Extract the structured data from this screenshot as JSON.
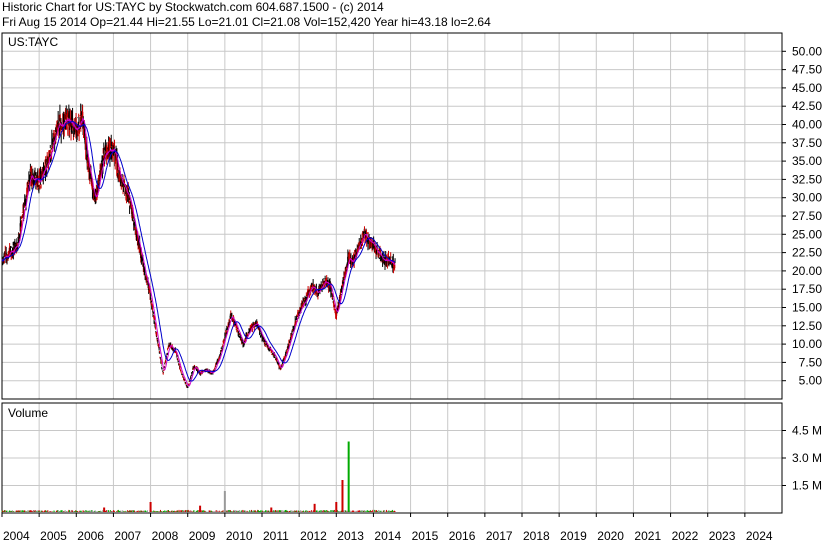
{
  "header": {
    "line1": "Historic Chart for US:TAYC by Stockwatch.com 604.687.1500 - (c) 2014",
    "line2": "Fri Aug 15 2014   Op=21.44  Hi=21.55  Lo=21.01  Cl=21.08  Vol=152,420  Year hi=43.18  lo=2.64"
  },
  "price_panel": {
    "label": "US:TAYC",
    "y_ticks": [
      "50.00",
      "47.50",
      "45.00",
      "42.50",
      "40.00",
      "37.50",
      "35.00",
      "32.50",
      "30.00",
      "27.50",
      "25.00",
      "22.50",
      "20.00",
      "17.50",
      "15.00",
      "12.50",
      "10.00",
      "7.50",
      "5.00"
    ]
  },
  "volume_panel": {
    "label": "Volume",
    "y_ticks": [
      "4.5 M",
      "3.0 M",
      "1.5 M"
    ]
  },
  "x_labels": [
    "2004",
    "2005",
    "2006",
    "2007",
    "2008",
    "2009",
    "2010",
    "2011",
    "2012",
    "2013",
    "2014",
    "2015",
    "2016",
    "2017",
    "2018",
    "2019",
    "2020",
    "2021",
    "2022",
    "2023",
    "2024"
  ],
  "colors": {
    "grid": "#c8c8c8",
    "price_bar_up": "#cc0000",
    "price_bar_down": "#000000",
    "ma_short": "#cc00cc",
    "ma_long": "#0000cc",
    "volume_up": "#00aa00",
    "volume_down": "#cc0000",
    "volume_flat": "#999999"
  },
  "chart_data": {
    "type": "line",
    "title": "Historic Chart for US:TAYC",
    "price": {
      "ylim": [
        2.5,
        52.5
      ],
      "series": [
        {
          "x": [
            "2004-01",
            "2004-06",
            "2004-10",
            "2005-01",
            "2005-04",
            "2005-07",
            "2005-10",
            "2006-01",
            "2006-03",
            "2006-05",
            "2006-07",
            "2006-10",
            "2007-01",
            "2007-03",
            "2007-06",
            "2007-09",
            "2007-11",
            "2008-01",
            "2008-03",
            "2008-05",
            "2008-07",
            "2008-09",
            "2008-11",
            "2009-01",
            "2009-03",
            "2009-05",
            "2009-07",
            "2009-09",
            "2009-11",
            "2010-01",
            "2010-03",
            "2010-05",
            "2010-07",
            "2010-09",
            "2010-11",
            "2011-01",
            "2011-03",
            "2011-05",
            "2011-07",
            "2011-09",
            "2011-11",
            "2012-01",
            "2012-03",
            "2012-05",
            "2012-07",
            "2012-09",
            "2012-11",
            "2013-01",
            "2013-03",
            "2013-05",
            "2013-06",
            "2013-08",
            "2013-10",
            "2013-12",
            "2014-02",
            "2014-04",
            "2014-06",
            "2014-08"
          ],
          "values": [
            21.5,
            23.5,
            33,
            32,
            35,
            40,
            40.5,
            39.5,
            41,
            34,
            29.5,
            36,
            37,
            33,
            30,
            24,
            20,
            16.5,
            11,
            6,
            10,
            9,
            6,
            4,
            7,
            6,
            6.5,
            6,
            8,
            11,
            14,
            12,
            10,
            12,
            13,
            11,
            9.5,
            8.5,
            6.5,
            9,
            12,
            14.5,
            16,
            18,
            17,
            18.5,
            18,
            14,
            18,
            22,
            21,
            23,
            25,
            24,
            23,
            21.5,
            21.3,
            21.08
          ]
        }
      ]
    },
    "volume": {
      "ylim": [
        0,
        6.0
      ],
      "unit": "M",
      "x": [
        "2006-10",
        "2008-01",
        "2009-05",
        "2010-01",
        "2011-04",
        "2012-06",
        "2013-01",
        "2013-03",
        "2013-05"
      ],
      "values": [
        0.3,
        0.6,
        0.4,
        1.2,
        0.3,
        0.5,
        0.6,
        1.8,
        3.9
      ]
    },
    "xlim": [
      "2004-01",
      "2024-12"
    ]
  }
}
